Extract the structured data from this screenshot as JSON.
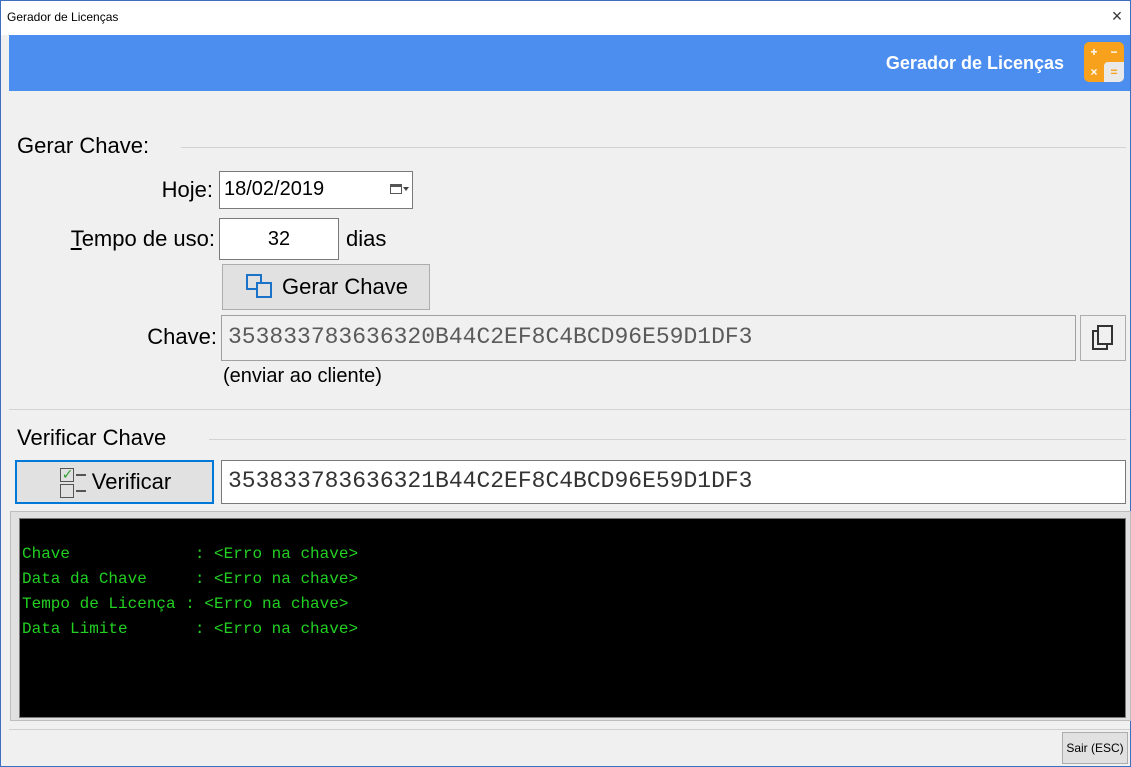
{
  "window": {
    "title": "Gerador de Licenças",
    "close_glyph": "×"
  },
  "header": {
    "title": "Gerador de Licenças",
    "icon": "calculator-icon",
    "icon_color": "#f8a11c",
    "bar_color": "#4c8df0"
  },
  "generate": {
    "section_label": "Gerar Chave:",
    "today_label": "Hoje:",
    "today_value": "18/02/2019",
    "usage_label": "Tempo de uso:",
    "usage_value": "32",
    "usage_unit": "dias",
    "button_label": "Gerar Chave",
    "key_label": "Chave:",
    "key_value": "353833783636320B44C2EF8C4BCD96E59D1DF3",
    "hint": "(enviar ao cliente)"
  },
  "verify": {
    "section_label": "Verificar Chave",
    "button_label": "Verificar",
    "key_value": "353833783636321B44C2EF8C4BCD96E59D1DF3"
  },
  "console": {
    "text_color": "#22d022",
    "lines": [
      "Chave             : <Erro na chave>",
      "Data da Chave     : <Erro na chave>",
      "Tempo de Licença : <Erro na chave>",
      "Data Limite       : <Erro na chave>"
    ]
  },
  "footer": {
    "exit_label": "Sair (ESC)"
  }
}
